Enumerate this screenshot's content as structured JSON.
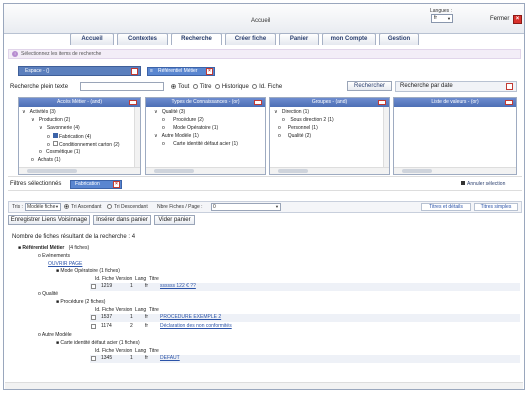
{
  "window": {
    "title": "Accueil",
    "languages_label": "Langues :",
    "language_value": "fr",
    "close_label": "Fermer"
  },
  "tabs": [
    {
      "label": "Accueil"
    },
    {
      "label": "Contextes"
    },
    {
      "label": "Recherche"
    },
    {
      "label": "Créer fiche"
    },
    {
      "label": "Panier"
    },
    {
      "label": "mon Compte"
    },
    {
      "label": "Gestion"
    }
  ],
  "info": {
    "text": "Sélectionnez les items de recherche"
  },
  "espace": {
    "label": "Espace - ()"
  },
  "ref_filter": {
    "label": "Référentiel Métier"
  },
  "search": {
    "label": "Recherche plein texte",
    "value": "",
    "options": [
      "Tout",
      "Titre",
      "Historique",
      "Id. Fiche"
    ],
    "button": "Rechercher",
    "date_label": "Recherche par date"
  },
  "panels": {
    "metier": {
      "title": "Accès Métier - (and)",
      "items": [
        {
          "prefix": "∨",
          "label": "Activités",
          "count": "(3)"
        },
        {
          "prefix": "∨",
          "label": "Production",
          "count": "(2)"
        },
        {
          "prefix": "∨",
          "label": "Savonnerie",
          "count": "(4)"
        },
        {
          "prefix": "o",
          "label": "Fabrication",
          "count": "(4)"
        },
        {
          "prefix": "o",
          "label": "Conditionnement carton",
          "count": "(2)"
        },
        {
          "prefix": "o",
          "label": "Cosmétique",
          "count": "(1)"
        },
        {
          "prefix": "o",
          "label": "Achats",
          "count": "(1)"
        }
      ]
    },
    "types": {
      "title": "Types de Connaissances - (or)",
      "items": [
        {
          "prefix": "∨",
          "label": "Qualité",
          "count": "(3)"
        },
        {
          "prefix": "o",
          "label": "Procédure",
          "count": "(2)"
        },
        {
          "prefix": "o",
          "label": "Mode Opératoire",
          "count": "(1)"
        },
        {
          "prefix": "∨",
          "label": "Autre Modèle",
          "count": "(1)"
        },
        {
          "prefix": "o",
          "label": "Carte identité défaut acier",
          "count": "(1)"
        }
      ]
    },
    "groupes": {
      "title": "Groupes - (and)",
      "items": [
        {
          "prefix": "∨",
          "label": "Direction",
          "count": "(1)"
        },
        {
          "prefix": "o",
          "label": "Sous direction 2",
          "count": "(1)"
        },
        {
          "prefix": "o",
          "label": "Personnel",
          "count": "(1)"
        },
        {
          "prefix": "o",
          "label": "Qualité",
          "count": "(2)"
        }
      ]
    },
    "valeurs": {
      "title": "Liste de valeurs - (or)"
    }
  },
  "filters": {
    "label": "Filtres sélectionnés",
    "chip": "Fabrication",
    "cancel": "Annuler sélection"
  },
  "sort": {
    "label": "Tris :",
    "field": "Modèle fiche",
    "asc": "Tri Ascendant",
    "desc": "Tri Descendant",
    "per_page_label": "Nbre Fiches / Page :",
    "per_page": "0",
    "view_detail": "Titres et détails",
    "view_simple": "Titres simples"
  },
  "actions": {
    "save": "Enregistrer Liens Voisinnage",
    "add_cart": "Insérer dans panier",
    "empty_cart": "Vider panier"
  },
  "results": {
    "count_text": "Nombre de fiches résultant de la recherche : 4",
    "root_label": "Référentiel Métier",
    "root_count": "(4 fiches)",
    "columns": [
      "Id. Fiche",
      "Version",
      "Lang",
      "Titre"
    ],
    "groups": [
      {
        "name": "Evénements",
        "link": "OUVRIR PAGE",
        "sub": "Mode Opératoire (1 fiches)",
        "rows": [
          {
            "id": "1219",
            "version": "1",
            "lang": "fr",
            "title": "ssssss 122 € ??"
          }
        ]
      },
      {
        "name": "Qualité",
        "sub": "Procédure (2 fiches)",
        "rows": [
          {
            "id": "1537",
            "version": "1",
            "lang": "fr",
            "title": "PROCEDURE EXEMPLE 2"
          },
          {
            "id": "1174",
            "version": "2",
            "lang": "fr",
            "title": "Déclaration des non conformités"
          }
        ]
      },
      {
        "name": "Autre Modèle",
        "sub": "Carte identité défaut acier (1 fiches)",
        "rows": [
          {
            "id": "1345",
            "version": "1",
            "lang": "fr",
            "title": "DEFAUT"
          }
        ]
      }
    ]
  }
}
